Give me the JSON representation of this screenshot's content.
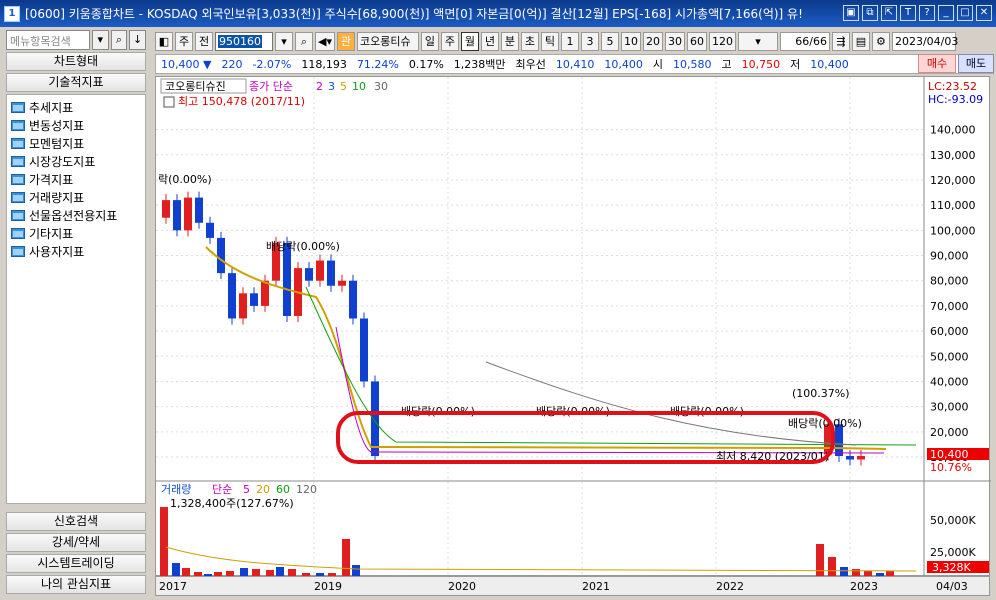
{
  "title": {
    "bar_text": "[0600] 키움종합차트 - KOSDAQ 외국인보유[3,033(천)] 주식수[68,900(천)] 액면[0] 자본금[0(억)] 결산[12월] EPS[-168] 시가총액[7,166(억)] 유!",
    "app_icon": "1"
  },
  "left": {
    "search_placeholder": "메뉴항목검색",
    "chart_type": "차트형태",
    "tech": "기술적지표",
    "items": [
      "추세지표",
      "변동성지표",
      "모멘텀지표",
      "시장강도지표",
      "가격지표",
      "거래량지표",
      "선물옵션전용지표",
      "기타지표",
      "사용자지표"
    ],
    "bottom": [
      "신호검색",
      "강세/약세",
      "시스템트레이딩",
      "나의 관심지표"
    ]
  },
  "toolbar": {
    "mode1": "주",
    "mode2": "전",
    "code": "950160",
    "name": "코오롱티슈",
    "badge": "관",
    "periods": [
      "일",
      "주",
      "월",
      "년",
      "분",
      "초",
      "틱"
    ],
    "selected_period": "월",
    "nums": [
      "1",
      "3",
      "5",
      "10",
      "20",
      "30",
      "60",
      "120"
    ],
    "count": "66/66",
    "date": "2023/04/03",
    "buy": "매수",
    "sell": "매도"
  },
  "quote": {
    "price": "10,400 ▼",
    "change": "220",
    "pct": "-2.07%",
    "volume": "118,193",
    "rate1": "71.24%",
    "rate2": "0.17%",
    "amount": "1,238백만",
    "best_label": "최우선",
    "bid1": "10,410",
    "bid2": "10,400",
    "open_label": "시",
    "open": "10,580",
    "high_label": "고",
    "high": "10,750",
    "low_label": "저",
    "low": "10,400"
  },
  "chart": {
    "legend": {
      "name": "코오롱티슈진",
      "ma_label": "종가 단순",
      "ma": [
        "2",
        "3",
        "5",
        "10",
        "30"
      ]
    },
    "lc": "LC:23.52",
    "hc": "HC:-93.09",
    "max_label": "최고 150,478 (2017/11)",
    "min_label": "최저 8,420 (2023/01)",
    "annotations": [
      "락(0.00%)",
      "배당락(0.00%)",
      "배당락(0.00%)",
      "배당락(0.00%)",
      "배당락(0.00%)",
      "(100.37%)",
      "배당락(0.00%)"
    ],
    "price_ticks": [
      "140,000",
      "130,000",
      "120,000",
      "110,000",
      "100,000",
      "90,000",
      "80,000",
      "70,000",
      "60,000",
      "50,000",
      "40,000",
      "30,000",
      "20,000",
      "10,000"
    ],
    "cur_price": "10,400",
    "cur_pct": "10.76%",
    "vol_legend": {
      "name": "거래량",
      "ma_label": "단순",
      "ma": [
        "5",
        "20",
        "60",
        "120"
      ]
    },
    "vol_max": "1,328,400주(127.67%)",
    "vol_ticks": [
      "50,000K",
      "25,000K"
    ],
    "vol_cur": "3,328K",
    "vol_pct": "127.67%",
    "x_labels": [
      "2017",
      "2019",
      "2020",
      "2021",
      "2022",
      "2023",
      "04/03"
    ],
    "colors": {
      "up": "#e02020",
      "down": "#1040d0",
      "highlight": "#e0101a"
    }
  },
  "chart_data": {
    "type": "candlestick",
    "period": "monthly",
    "x_labels": [
      "2017",
      "2019",
      "2020",
      "2021",
      "2022",
      "2023"
    ],
    "y_range": [
      8420,
      150478
    ],
    "candles": [
      {
        "o": 105000,
        "c": 112000
      },
      {
        "o": 112000,
        "c": 100000
      },
      {
        "o": 100000,
        "c": 113000
      },
      {
        "o": 113000,
        "c": 103000
      },
      {
        "o": 103000,
        "c": 97000
      },
      {
        "o": 97000,
        "c": 83000
      },
      {
        "o": 83000,
        "c": 65000
      },
      {
        "o": 65000,
        "c": 75000
      },
      {
        "o": 75000,
        "c": 70000
      },
      {
        "o": 70000,
        "c": 80000
      },
      {
        "o": 80000,
        "c": 95000
      },
      {
        "o": 95000,
        "c": 66000
      },
      {
        "o": 66000,
        "c": 85000
      },
      {
        "o": 85000,
        "c": 80000
      },
      {
        "o": 80000,
        "c": 88000
      },
      {
        "o": 88000,
        "c": 78000
      },
      {
        "o": 78000,
        "c": 80000
      },
      {
        "o": 80000,
        "c": 65000
      },
      {
        "o": 65000,
        "c": 40000
      },
      {
        "o": 40000,
        "c": 10400
      },
      {
        "o": 11000,
        "c": 23000
      },
      {
        "o": 23000,
        "c": 10400
      },
      {
        "o": 10400,
        "c": 9000
      },
      {
        "o": 9000,
        "c": 10400
      }
    ],
    "volume": {
      "max": "1,328,400주",
      "current": "3,328K"
    }
  }
}
